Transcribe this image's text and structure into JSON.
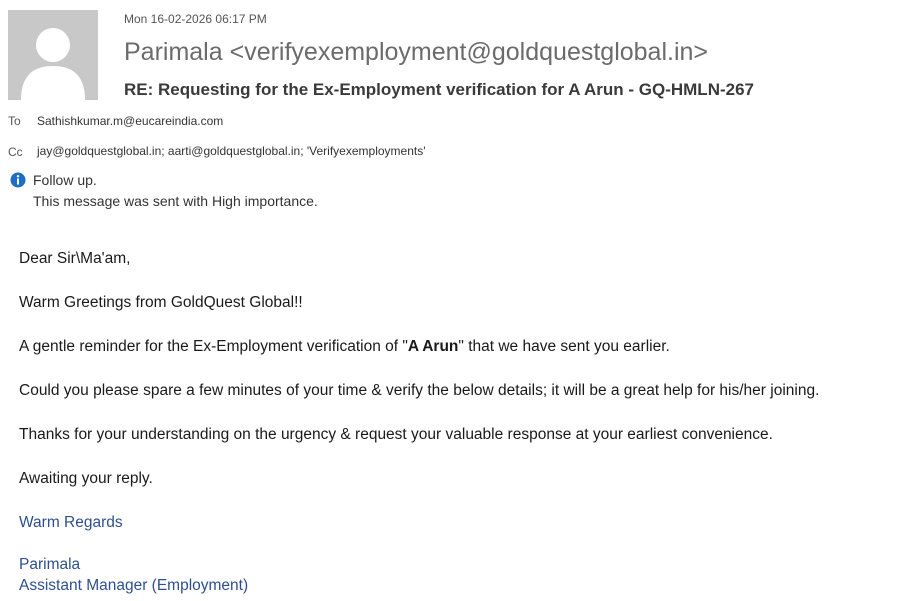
{
  "message": {
    "date": "Mon 16-02-2026 06:17 PM",
    "sender": "Parimala <verifyexemployment@goldquestglobal.in>",
    "subject": "RE: Requesting for the Ex-Employment verification for A Arun - GQ-HMLN-267",
    "to_label": "To",
    "to_value": "Sathishkumar.m@eucareindia.com",
    "cc_label": "Cc",
    "cc_value": "jay@goldquestglobal.in; aarti@goldquestglobal.in; 'Verifyexemployments'",
    "flag_text": "Follow up.",
    "importance_text": "This message was sent with High importance."
  },
  "body": {
    "greeting": "Dear Sir\\Ma'am,",
    "line1": "Warm Greetings from GoldQuest Global!!",
    "line2_prefix": "A gentle reminder for the Ex-Employment verification of \"",
    "line2_name": "A Arun",
    "line2_suffix": "\" that we have sent you earlier.",
    "line3": "Could you please spare a few minutes of your time & verify the below details; it will be a great help for his/her joining.",
    "line4": "Thanks for your understanding on the urgency & request your valuable response at your earliest convenience.",
    "line5": "Awaiting your reply.",
    "regards": "Warm Regards",
    "sig_name": "Parimala",
    "sig_title": "Assistant Manager (Employment)"
  },
  "colors": {
    "signature_blue": "#2e4f8f",
    "info_icon_blue": "#1e6fc3"
  },
  "icons": {
    "avatar": "person-avatar-icon",
    "info": "info-icon"
  }
}
